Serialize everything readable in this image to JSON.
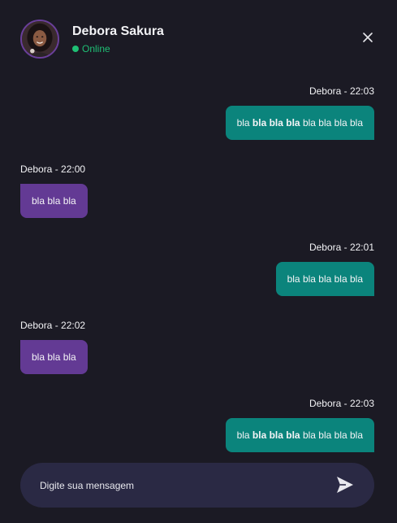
{
  "header": {
    "name": "Debora Sakura",
    "status": "Online",
    "avatar_icon": "user-avatar-photo",
    "close_icon": "close-icon"
  },
  "colors": {
    "background": "#1b1a24",
    "sent_bubble": "#0b847c",
    "received_bubble": "#633a94",
    "online": "#1fbf75",
    "composer": "#2a2944"
  },
  "messages": [
    {
      "direction": "sent",
      "label": "Debora - 22:03",
      "parts": [
        {
          "text": "bla ",
          "bold": false
        },
        {
          "text": "bla bla bla",
          "bold": true
        },
        {
          "text": " bla bla bla bla",
          "bold": false
        }
      ]
    },
    {
      "direction": "received",
      "label": "Debora - 22:00",
      "parts": [
        {
          "text": "bla bla bla",
          "bold": false
        }
      ]
    },
    {
      "direction": "sent",
      "label": "Debora - 22:01",
      "parts": [
        {
          "text": "bla bla bla bla bla",
          "bold": false
        }
      ]
    },
    {
      "direction": "received",
      "label": "Debora - 22:02",
      "parts": [
        {
          "text": "bla bla bla",
          "bold": false
        }
      ]
    },
    {
      "direction": "sent",
      "label": "Debora - 22:03",
      "parts": [
        {
          "text": "bla ",
          "bold": false
        },
        {
          "text": "bla bla bla",
          "bold": true
        },
        {
          "text": " bla bla bla bla",
          "bold": false
        }
      ]
    }
  ],
  "composer": {
    "placeholder": "Digite sua mensagem",
    "value": "",
    "send_icon": "send-icon"
  }
}
